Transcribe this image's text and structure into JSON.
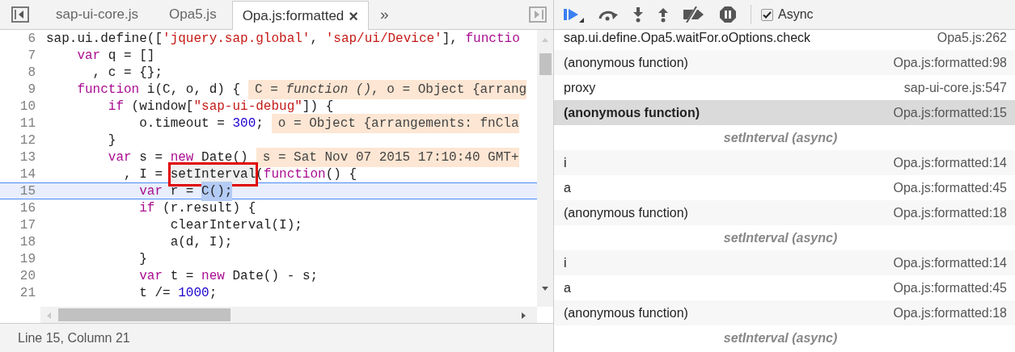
{
  "tabs": [
    {
      "label": "sap-ui-core.js",
      "selected": false
    },
    {
      "label": "Opa5.js",
      "selected": false
    },
    {
      "label": "Opa.js:formatted",
      "selected": true,
      "close_glyph": "×"
    }
  ],
  "more_tabs": "»",
  "editor": {
    "lines": [
      {
        "number": "6",
        "current": false,
        "tokens": [
          {
            "kind": "plain",
            "t": "sap.ui.define(["
          },
          {
            "kind": "str",
            "t": "'jquery.sap.global'"
          },
          {
            "kind": "plain",
            "t": ", "
          },
          {
            "kind": "str",
            "t": "'sap/ui/Device'"
          },
          {
            "kind": "plain",
            "t": "], "
          },
          {
            "kind": "kw",
            "t": "functio"
          }
        ]
      },
      {
        "number": "7",
        "current": false,
        "tokens": [
          {
            "kind": "kw",
            "t": "    var"
          },
          {
            "kind": "plain",
            "t": " q = []"
          }
        ]
      },
      {
        "number": "8",
        "current": false,
        "tokens": [
          {
            "kind": "plain",
            "t": "      , c = {};"
          }
        ]
      },
      {
        "number": "9",
        "current": false,
        "tokens": [
          {
            "kind": "kw",
            "t": "    function"
          },
          {
            "kind": "plain",
            "t": " i(C, o, d) {"
          }
        ],
        "inline_value": "C = *function ()*, o = Object {arrang"
      },
      {
        "number": "10",
        "current": false,
        "tokens": [
          {
            "kind": "kw",
            "t": "        if"
          },
          {
            "kind": "plain",
            "t": " (window["
          },
          {
            "kind": "str",
            "t": "\"sap-ui-debug\""
          },
          {
            "kind": "plain",
            "t": "]) {"
          }
        ]
      },
      {
        "number": "11",
        "current": false,
        "tokens": [
          {
            "kind": "plain",
            "t": "            o.timeout = "
          },
          {
            "kind": "num",
            "t": "300"
          },
          {
            "kind": "plain",
            "t": ";"
          }
        ],
        "inline_value": "o = Object {arrangements: fnCla"
      },
      {
        "number": "12",
        "current": false,
        "tokens": [
          {
            "kind": "plain",
            "t": "        }"
          }
        ]
      },
      {
        "number": "13",
        "current": false,
        "tokens": [
          {
            "kind": "kw",
            "t": "        var"
          },
          {
            "kind": "plain",
            "t": " s = "
          },
          {
            "kind": "kw",
            "t": "new"
          },
          {
            "kind": "plain",
            "t": " Date()"
          }
        ],
        "inline_value": "s = Sat Nov 07 2015 17:10:40 GMT+"
      },
      {
        "number": "14",
        "current": false,
        "tokens": [
          {
            "kind": "plain",
            "t": "          , I = "
          },
          {
            "kind": "boxed",
            "t": "setInterval"
          },
          {
            "kind": "plain",
            "t": "("
          },
          {
            "kind": "kw",
            "t": "function"
          },
          {
            "kind": "plain",
            "t": "() {"
          }
        ]
      },
      {
        "number": "15",
        "current": true,
        "tokens": [
          {
            "kind": "kw",
            "t": "            var"
          },
          {
            "kind": "plain",
            "t": " r = "
          },
          {
            "kind": "sel",
            "t": "C();"
          }
        ]
      },
      {
        "number": "16",
        "current": false,
        "tokens": [
          {
            "kind": "kw",
            "t": "            if"
          },
          {
            "kind": "plain",
            "t": " (r.result) {"
          }
        ]
      },
      {
        "number": "17",
        "current": false,
        "tokens": [
          {
            "kind": "plain",
            "t": "                clearInterval(I);"
          }
        ]
      },
      {
        "number": "18",
        "current": false,
        "tokens": [
          {
            "kind": "plain",
            "t": "                a(d, I);"
          }
        ]
      },
      {
        "number": "19",
        "current": false,
        "tokens": [
          {
            "kind": "plain",
            "t": "            }"
          }
        ]
      },
      {
        "number": "20",
        "current": false,
        "tokens": [
          {
            "kind": "kw",
            "t": "            var"
          },
          {
            "kind": "plain",
            "t": " t = "
          },
          {
            "kind": "kw",
            "t": "new"
          },
          {
            "kind": "plain",
            "t": " Date() - s;"
          }
        ]
      },
      {
        "number": "21",
        "current": false,
        "tokens": [
          {
            "kind": "plain",
            "t": "            t /= "
          },
          {
            "kind": "num",
            "t": "1000"
          },
          {
            "kind": "plain",
            "t": ";"
          }
        ]
      }
    ]
  },
  "status_bar": "Line 15, Column 21",
  "debugger": {
    "async": {
      "label": "Async",
      "checked": true
    },
    "call_stack": [
      {
        "kind": "frame",
        "name": "sap.ui.define.Opa5.waitFor.oOptions.check",
        "location": "Opa5.js:262",
        "selected": false
      },
      {
        "kind": "frame",
        "name": "(anonymous function)",
        "location": "Opa.js:formatted:98",
        "selected": false
      },
      {
        "kind": "frame",
        "name": "proxy",
        "location": "sap-ui-core.js:547",
        "selected": false
      },
      {
        "kind": "frame",
        "name": "(anonymous function)",
        "location": "Opa.js:formatted:15",
        "selected": true
      },
      {
        "kind": "async",
        "label": "setInterval (async)"
      },
      {
        "kind": "frame",
        "name": "i",
        "location": "Opa.js:formatted:14",
        "selected": false
      },
      {
        "kind": "frame",
        "name": "a",
        "location": "Opa.js:formatted:45",
        "selected": false
      },
      {
        "kind": "frame",
        "name": "(anonymous function)",
        "location": "Opa.js:formatted:18",
        "selected": false
      },
      {
        "kind": "async",
        "label": "setInterval (async)"
      },
      {
        "kind": "frame",
        "name": "i",
        "location": "Opa.js:formatted:14",
        "selected": false
      },
      {
        "kind": "frame",
        "name": "a",
        "location": "Opa.js:formatted:45",
        "selected": false
      },
      {
        "kind": "frame",
        "name": "(anonymous function)",
        "location": "Opa.js:formatted:18",
        "selected": false
      },
      {
        "kind": "async",
        "label": "setInterval (async)"
      }
    ]
  }
}
